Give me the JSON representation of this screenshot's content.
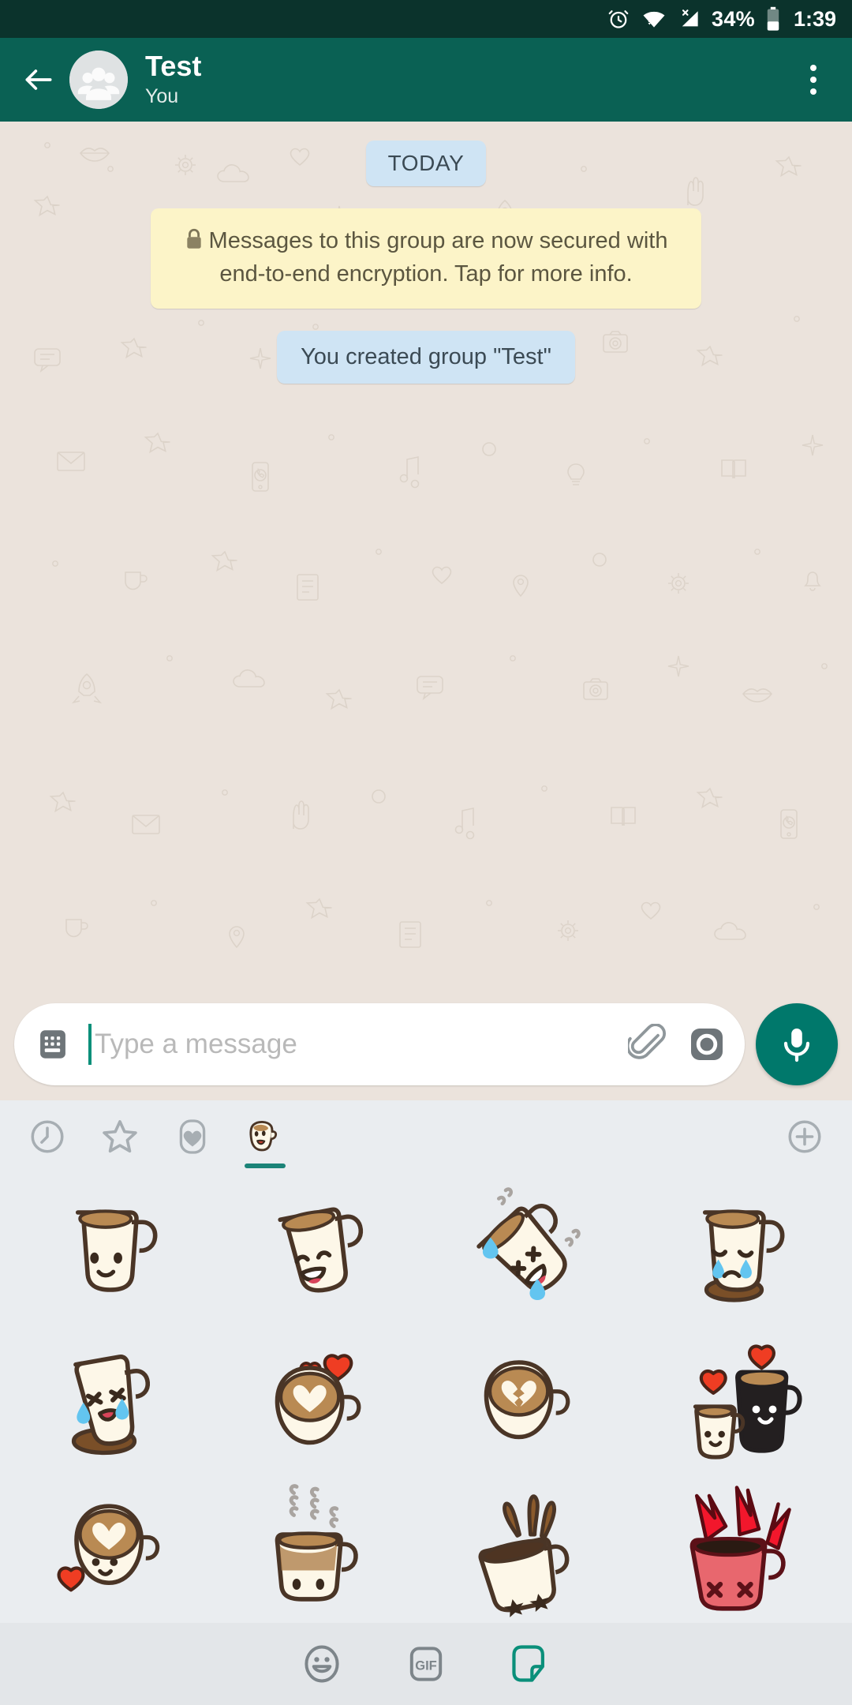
{
  "statusbar": {
    "alarm_icon": "alarm-clock-icon",
    "wifi_icon": "wifi-icon",
    "cellular_icon": "cellular-no-sim-icon",
    "battery_percent": "34%",
    "battery_icon": "battery-icon",
    "time": "1:39"
  },
  "appbar": {
    "back_icon": "back-arrow-icon",
    "avatar_icon": "group-avatar-icon",
    "title": "Test",
    "subtitle": "You",
    "menu_icon": "overflow-menu-icon"
  },
  "chat": {
    "date_chip": "TODAY",
    "encryption_notice": "Messages to this group are now secured with end-to-end encryption. Tap for more info.",
    "lock_icon": "lock-icon",
    "system_message": "You created group \"Test\""
  },
  "input": {
    "keyboard_icon": "keyboard-icon",
    "placeholder": "Type a message",
    "value": "",
    "attach_icon": "paperclip-icon",
    "camera_icon": "camera-icon",
    "mic_icon": "microphone-icon"
  },
  "sticker_tabs": [
    {
      "name": "recents-tab",
      "icon": "clock-icon",
      "active": false
    },
    {
      "name": "starred-tab",
      "icon": "star-icon",
      "active": false
    },
    {
      "name": "favorites-tab",
      "icon": "heart-icon",
      "active": false
    },
    {
      "name": "coffee-pack-tab",
      "icon": "coffee-cup-icon",
      "active": true
    }
  ],
  "sticker_add": {
    "icon": "plus-icon",
    "label": ""
  },
  "stickers": [
    {
      "name": "smiling-cup-sticker"
    },
    {
      "name": "laughing-cup-sticker"
    },
    {
      "name": "laughing-crying-cup-sticker"
    },
    {
      "name": "crying-cup-sticker"
    },
    {
      "name": "sobbing-cup-sticker"
    },
    {
      "name": "latte-heart-cup-sticker"
    },
    {
      "name": "broken-heart-latte-sticker"
    },
    {
      "name": "couple-mugs-sticker"
    },
    {
      "name": "latte-art-heart-face-sticker"
    },
    {
      "name": "steaming-cup-sticker"
    },
    {
      "name": "splashing-coffee-sticker"
    },
    {
      "name": "angry-red-cup-sticker"
    }
  ],
  "bottombar": {
    "emoji_label": "",
    "emoji_icon": "emoji-smiley-icon",
    "gif_label": "GIF",
    "sticker_icon": "sticker-icon"
  },
  "colors": {
    "statusbar": "#0b332c",
    "appbar": "#0a6154",
    "chat_bg": "#ebe3dc",
    "system_bubble": "#cfe4f4",
    "encryption_bubble": "#fcf4c8",
    "accent": "#00786b",
    "panel_bg": "#eaedf0",
    "bottombar_bg": "#e3e6e9"
  }
}
